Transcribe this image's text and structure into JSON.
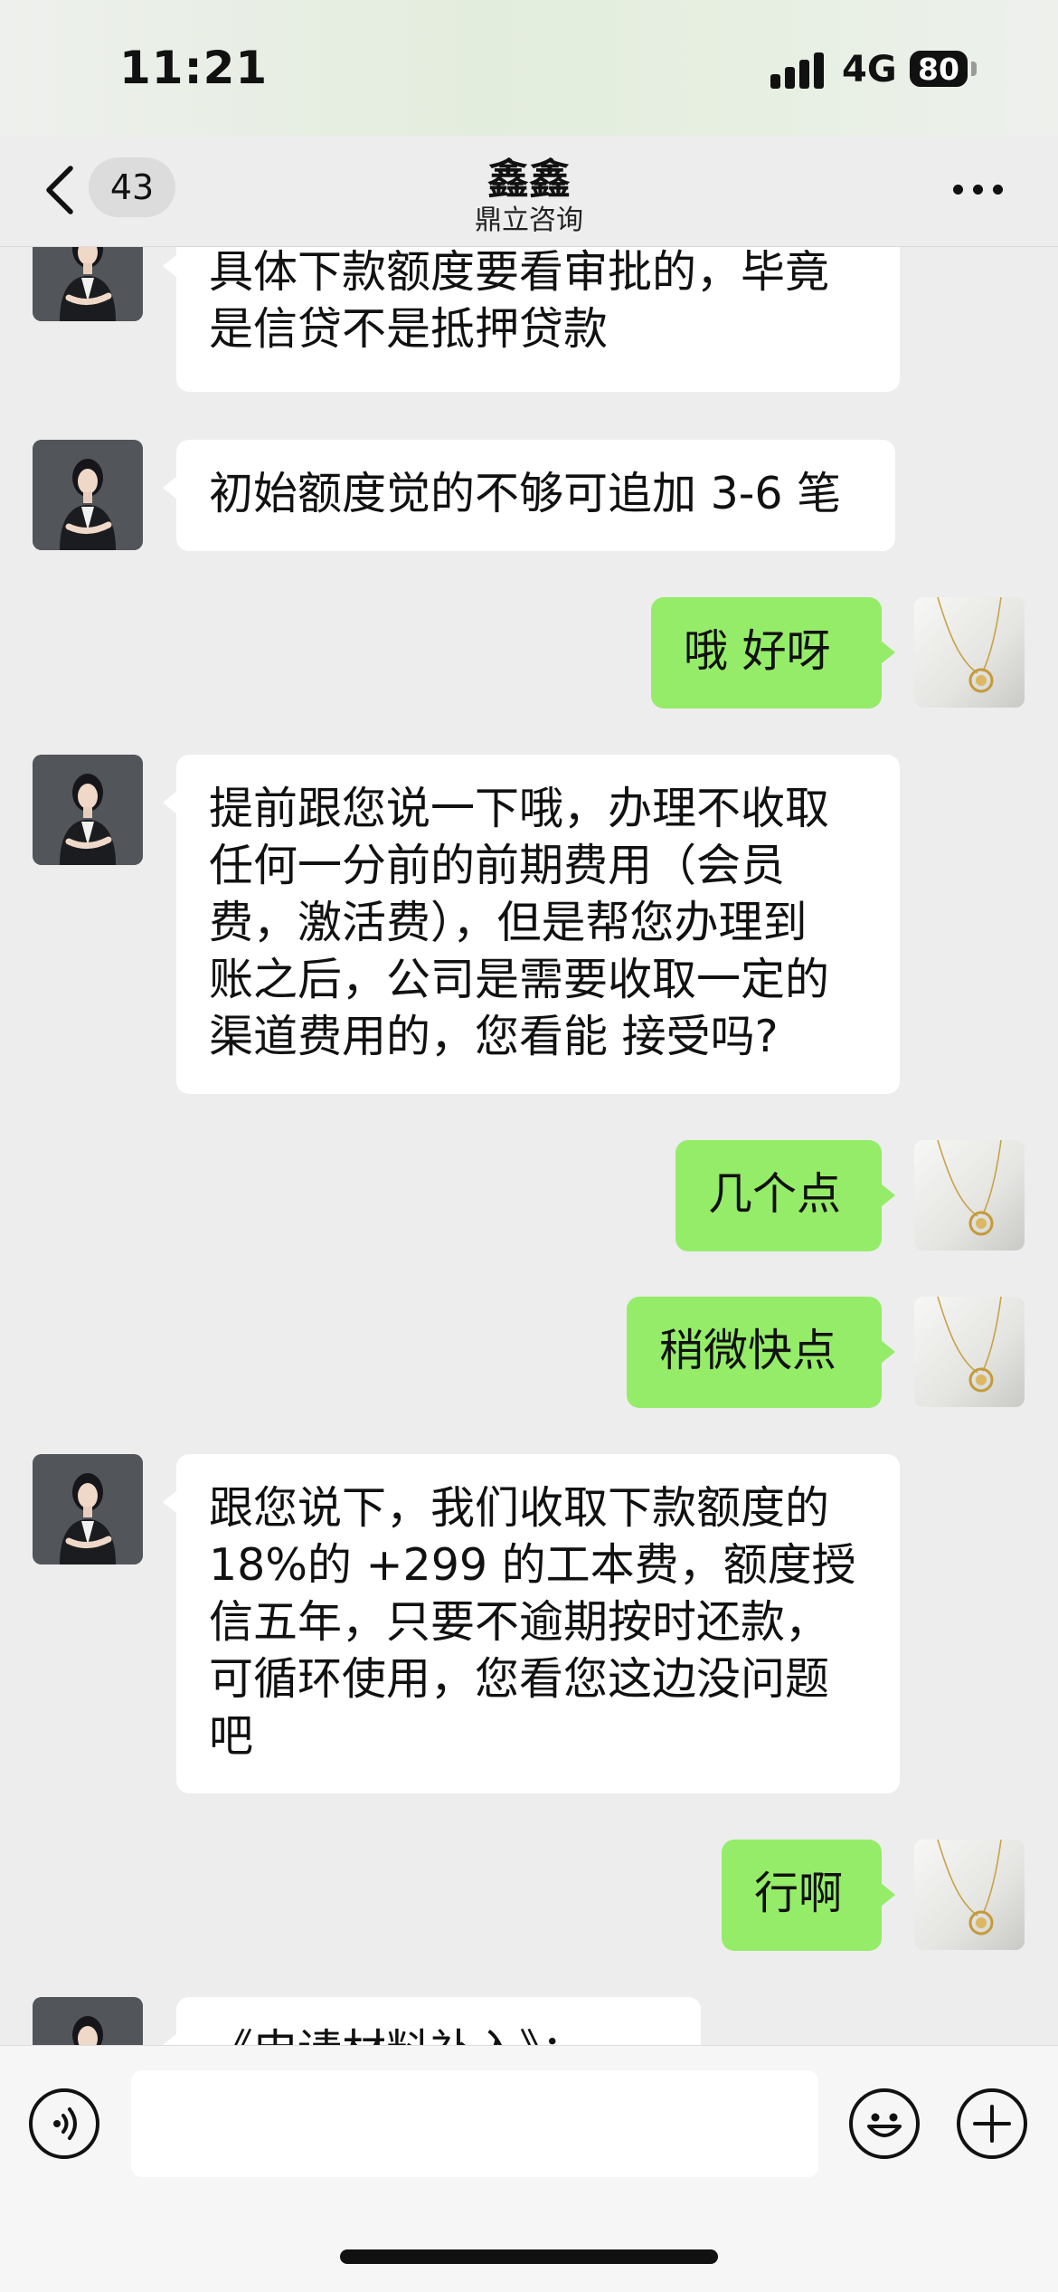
{
  "status_bar": {
    "time": "11:21",
    "network": "4G",
    "battery": "80"
  },
  "header": {
    "unread_count": "43",
    "title": "鑫鑫",
    "subtitle": "鼎立咨询"
  },
  "messages": [
    {
      "side": "left",
      "text": "具体下款额度要看审批的，毕竟\n是信贷不是抵押贷款"
    },
    {
      "side": "left",
      "text": "初始额度觉的不够可追加 3-6 笔"
    },
    {
      "side": "right",
      "text": "哦 好呀"
    },
    {
      "side": "left",
      "text": "提前跟您说一下哦，办理不收取\n任何一分前的前期费用（会员\n费，激活费），但是帮您办理到\n账之后，公司是需要收取一定的\n渠道费用的，您看能 接受吗?"
    },
    {
      "side": "right",
      "text": "几个点"
    },
    {
      "side": "right",
      "text": "稍微快点"
    },
    {
      "side": "left",
      "text": "跟您说下，我们收取下款额度的\n18%的 +299 的工本费，额度授\n信五年，只要不逾期按时还款，\n可循环使用，您看您这边没问题\n吧"
    },
    {
      "side": "right",
      "text": "行啊"
    },
    {
      "side": "left",
      "text": "《申请材料补入》："
    }
  ],
  "input": {
    "placeholder": "",
    "value": ""
  },
  "icons": {
    "back": "chevron-left-icon",
    "more": "more-dots-icon",
    "voice": "voice-icon",
    "emoji": "emoji-icon",
    "add": "plus-icon"
  },
  "colors": {
    "background": "#ededed",
    "sent_bubble": "#95ec69",
    "received_bubble": "#ffffff"
  }
}
